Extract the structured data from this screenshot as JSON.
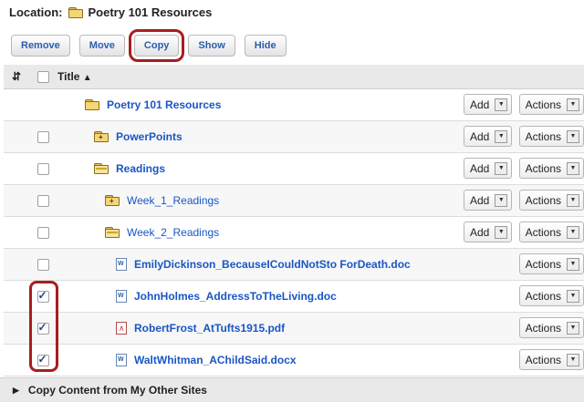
{
  "location": {
    "label": "Location:",
    "value": "Poetry 101 Resources"
  },
  "toolbar": {
    "remove": "Remove",
    "move": "Move",
    "copy": "Copy",
    "show": "Show",
    "hide": "Hide"
  },
  "table": {
    "title_header": "Title"
  },
  "controls": {
    "add": "Add",
    "actions": "Actions"
  },
  "rows": [
    {
      "name": "Poetry 101 Resources",
      "kind": "folder-root"
    },
    {
      "name": "PowerPoints",
      "kind": "folder-closed"
    },
    {
      "name": "Readings",
      "kind": "folder-open"
    },
    {
      "name": "Week_1_Readings",
      "kind": "folder-closed"
    },
    {
      "name": "Week_2_Readings",
      "kind": "folder-open"
    },
    {
      "name": "EmilyDickinson_BecauseICouldNotSto ForDeath.doc",
      "kind": "doc",
      "checked": false
    },
    {
      "name": "JohnHolmes_AddressToTheLiving.doc",
      "kind": "doc",
      "checked": true
    },
    {
      "name": "RobertFrost_AtTufts1915.pdf",
      "kind": "pdf",
      "checked": true
    },
    {
      "name": "WaltWhitman_AChildSaid.docx",
      "kind": "doc",
      "checked": true
    }
  ],
  "footer": {
    "label": "Copy Content from My Other Sites"
  }
}
